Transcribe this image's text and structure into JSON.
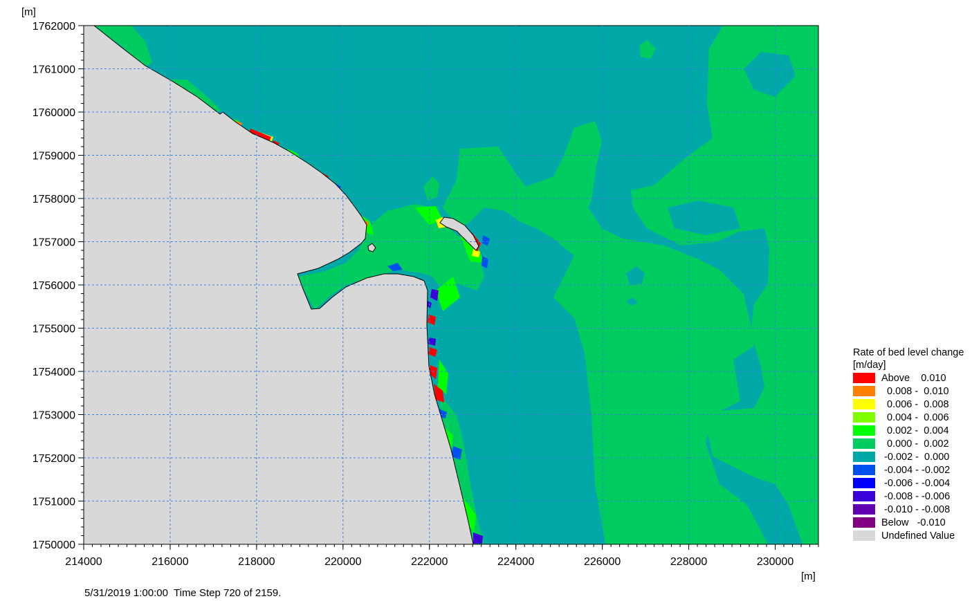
{
  "chart_data": {
    "type": "heatmap",
    "title": "",
    "x_unit": "[m]",
    "y_unit": "[m]",
    "xlim": [
      214000,
      231000
    ],
    "ylim": [
      1750000,
      1762000
    ],
    "x_ticks": [
      214000,
      216000,
      218000,
      220000,
      222000,
      224000,
      226000,
      228000,
      230000
    ],
    "y_ticks": [
      1750000,
      1751000,
      1752000,
      1753000,
      1754000,
      1755000,
      1756000,
      1757000,
      1758000,
      1759000,
      1760000,
      1761000,
      1762000
    ],
    "grid": true,
    "legend_position": "right",
    "legend": {
      "title": "Rate of bed level change",
      "unit": "[m/day]",
      "classes": [
        {
          "label": "Above    0.010",
          "color": "#ff0000"
        },
        {
          "label": "  0.008 -  0.010",
          "color": "#ff8000"
        },
        {
          "label": "  0.006 -  0.008",
          "color": "#ffff00"
        },
        {
          "label": "  0.004 -  0.006",
          "color": "#80ff00"
        },
        {
          "label": "  0.002 -  0.004",
          "color": "#00ff00"
        },
        {
          "label": "  0.000 -  0.002",
          "color": "#00cc60"
        },
        {
          "label": " -0.002 -  0.000",
          "color": "#00a8a8"
        },
        {
          "label": " -0.004 - -0.002",
          "color": "#0050f0"
        },
        {
          "label": " -0.006 - -0.004",
          "color": "#0000ff"
        },
        {
          "label": " -0.008 - -0.006",
          "color": "#3c00d8"
        },
        {
          "label": " -0.010 - -0.008",
          "color": "#6000b0"
        },
        {
          "label": "Below   -0.010",
          "color": "#800080"
        },
        {
          "label": "Undefined Value",
          "color": "#d8d8d8"
        }
      ]
    }
  },
  "status": {
    "text": "5/31/2019 1:00:00  Time Step 720 of 2159."
  }
}
